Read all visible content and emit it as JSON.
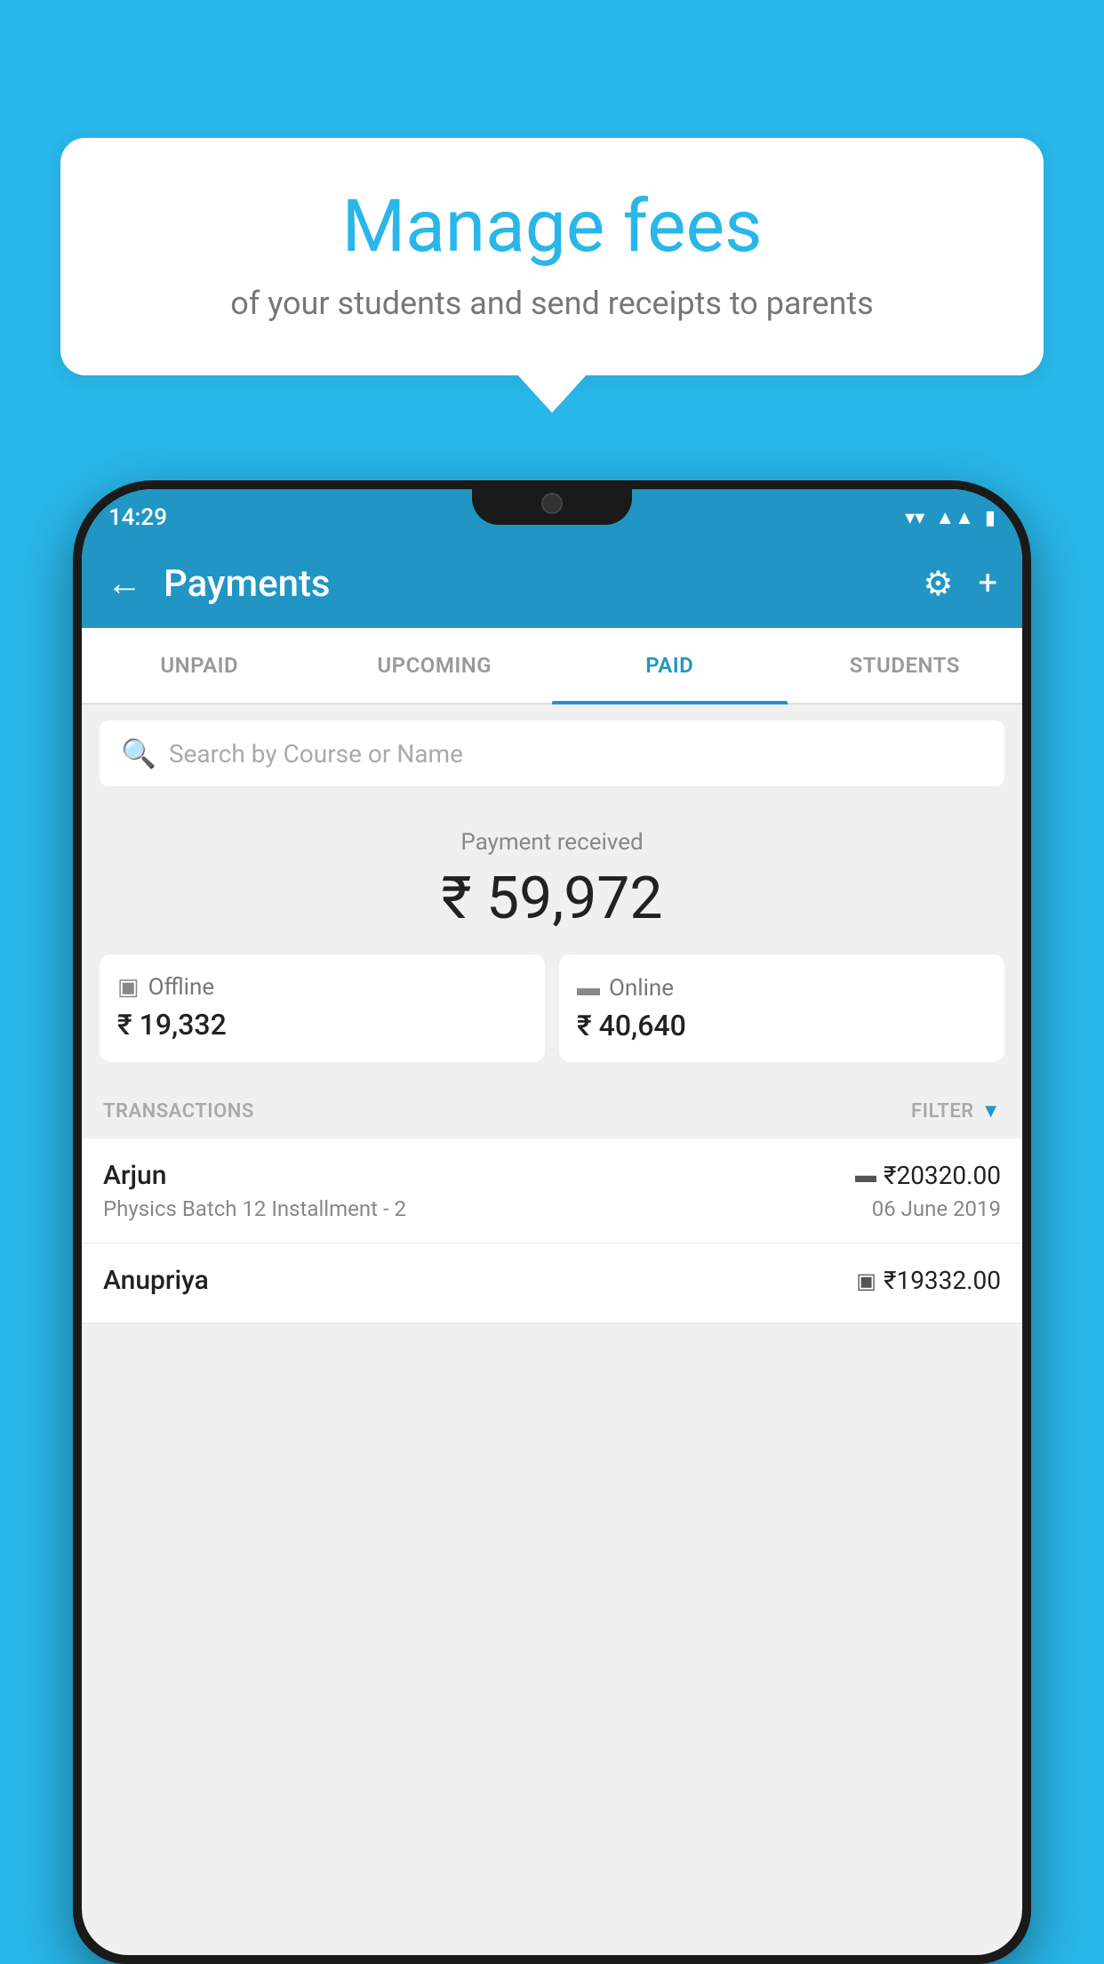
{
  "background_color": "#29b6e8",
  "speech_bubble": {
    "title": "Manage fees",
    "subtitle": "of your students and send receipts to parents"
  },
  "status_bar": {
    "time": "14:29",
    "wifi": "▼",
    "signal": "▲",
    "battery": "▌"
  },
  "app_bar": {
    "title": "Payments",
    "back_label": "←",
    "settings_label": "⚙",
    "add_label": "+"
  },
  "tabs": [
    {
      "label": "UNPAID",
      "active": false
    },
    {
      "label": "UPCOMING",
      "active": false
    },
    {
      "label": "PAID",
      "active": true
    },
    {
      "label": "STUDENTS",
      "active": false
    }
  ],
  "search": {
    "placeholder": "Search by Course or Name"
  },
  "payment_summary": {
    "label": "Payment received",
    "total": "₹ 59,972",
    "offline": {
      "label": "Offline",
      "amount": "₹ 19,332"
    },
    "online": {
      "label": "Online",
      "amount": "₹ 40,640"
    }
  },
  "transactions": {
    "label": "TRANSACTIONS",
    "filter_label": "FILTER",
    "items": [
      {
        "name": "Arjun",
        "course": "Physics Batch 12 Installment - 2",
        "amount": "₹20320.00",
        "date": "06 June 2019",
        "type": "online"
      },
      {
        "name": "Anupriya",
        "course": "",
        "amount": "₹19332.00",
        "date": "",
        "type": "offline"
      }
    ]
  }
}
